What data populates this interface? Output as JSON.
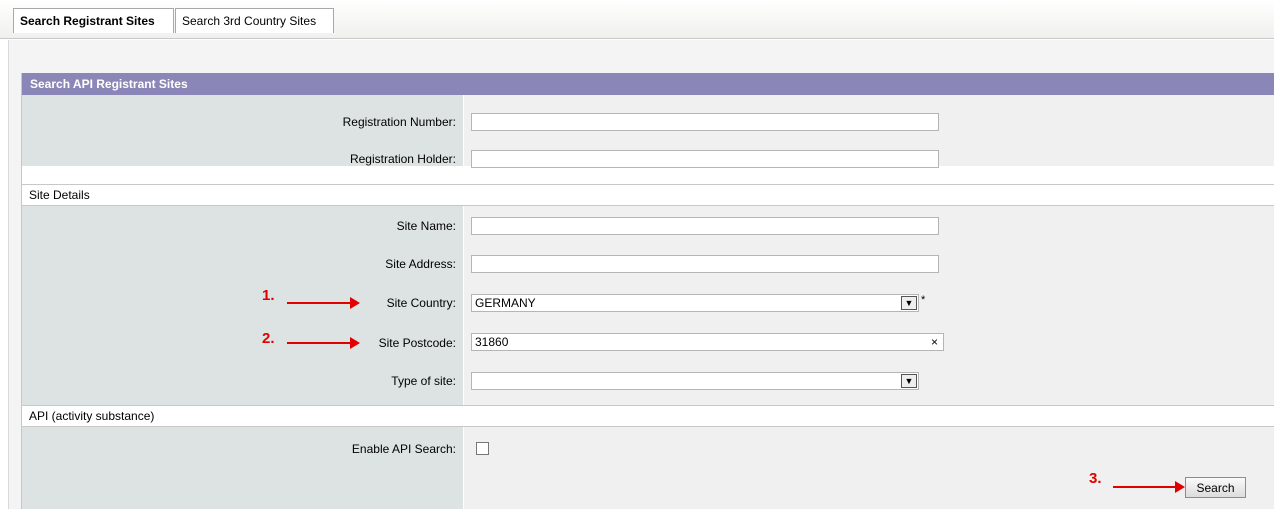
{
  "tabs": [
    {
      "label": "Search Registrant Sites",
      "active": true
    },
    {
      "label": "Search 3rd Country Sites",
      "active": false
    }
  ],
  "panel": {
    "title": "Search API Registrant Sites",
    "fields": {
      "registration_number": {
        "label": "Registration Number:",
        "value": ""
      },
      "registration_holder": {
        "label": "Registration Holder:",
        "value": ""
      },
      "site_name": {
        "label": "Site Name:",
        "value": ""
      },
      "site_address": {
        "label": "Site Address:",
        "value": ""
      },
      "site_country": {
        "label": "Site Country:",
        "value": "GERMANY",
        "required_mark": "*"
      },
      "site_postcode": {
        "label": "Site Postcode:",
        "value": "31860",
        "clear_glyph": "×"
      },
      "type_of_site": {
        "label": "Type of site:",
        "value": ""
      },
      "enable_api_search": {
        "label": "Enable API Search:",
        "checked": false
      }
    },
    "sections": {
      "site_details": "Site Details",
      "api": "API (activity substance)"
    },
    "search_button": "Search"
  },
  "annotations": [
    "1.",
    "2.",
    "3."
  ],
  "colors": {
    "header_bg": "#8a86b8",
    "label_bg": "#dde3e3",
    "annotation": "#e00000"
  }
}
